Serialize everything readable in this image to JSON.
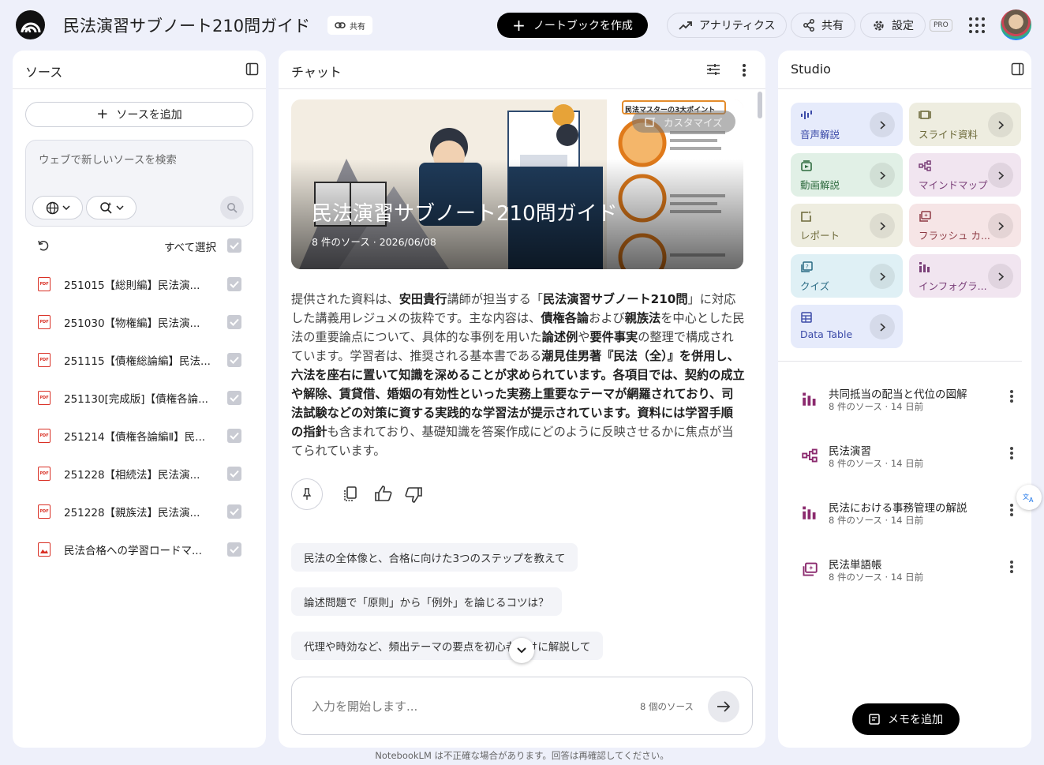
{
  "header": {
    "title": "民法演習サブノート210問ガイド",
    "share_chip": "共有",
    "create_button": "ノートブックを作成",
    "analytics_button": "アナリティクス",
    "share_button": "共有",
    "settings_button": "設定",
    "pro_badge": "PRO"
  },
  "sources": {
    "title": "ソース",
    "add_button": "ソースを追加",
    "search_placeholder": "ウェブで新しいソースを検索",
    "select_all": "すべて選択",
    "items": [
      {
        "label": "251015【総則編】民法演...",
        "type": "pdf"
      },
      {
        "label": "251030【物権編】民法演...",
        "type": "pdf"
      },
      {
        "label": "251115【債権総論編】民法...",
        "type": "pdf"
      },
      {
        "label": "251130[完成版]【債権各論...",
        "type": "pdf"
      },
      {
        "label": "251214【債権各論編Ⅱ】民...",
        "type": "pdf"
      },
      {
        "label": "251228【相続法】民法演...",
        "type": "pdf"
      },
      {
        "label": "251228【親族法】民法演...",
        "type": "pdf"
      },
      {
        "label": "民法合格への学習ロードマ...",
        "type": "image"
      }
    ]
  },
  "chat": {
    "title": "チャット",
    "hero_title": "民法演習サブノート210問ガイド",
    "hero_subtitle": "8 件のソース · 2026/06/08",
    "customize_button": "カスタマイズ",
    "infographic_heading": "民法マスターの3大ポイント",
    "summary_segments": [
      {
        "t": "提供された資料は、",
        "b": false
      },
      {
        "t": "安田貴行",
        "b": true
      },
      {
        "t": "講師が担当する「",
        "b": false
      },
      {
        "t": "民法演習サブノート210問",
        "b": true
      },
      {
        "t": "」に対応した講義用レジュメの抜粋です。主な内容は、",
        "b": false
      },
      {
        "t": "債権各論",
        "b": true
      },
      {
        "t": "および",
        "b": false
      },
      {
        "t": "親族法",
        "b": true
      },
      {
        "t": "を中心とした民法の重要論点について、具体的な事例を用いた",
        "b": false
      },
      {
        "t": "論述例",
        "b": true
      },
      {
        "t": "や",
        "b": false
      },
      {
        "t": "要件事実",
        "b": true
      },
      {
        "t": "の整理で構成されています。学習者は、推奨される基本書である",
        "b": false
      },
      {
        "t": "潮見佳男著『民法（全）』を併用し、六法を座右に置いて知識を深めることが求められています。各項目では、契約の成立や解除、賃貸借、婚姻の有効性といった実務上重要なテーマが網羅されており、司法試験などの対策に資する実践的な学習法が提示されています。資料には学習手順の指針",
        "b": true
      },
      {
        "t": "も含まれており、基礎知識を答案作成にどのように反映させるかに焦点が当てられています。",
        "b": false
      }
    ],
    "suggestions": [
      "民法の全体像と、合格に向けた3つのステップを教えて",
      "論述問題で「原則」から「例外」を論じるコツは？",
      "代理や時効など、頻出テーマの要点を初心者向けに解説して"
    ],
    "input_placeholder": "入力を開始します...",
    "source_count": "8 個のソース"
  },
  "studio": {
    "title": "Studio",
    "cards": [
      {
        "label": "音声解説",
        "bg": "#e6ebfb",
        "color": "#3b4aa8",
        "icon": "audio-icon"
      },
      {
        "label": "スライド資料",
        "bg": "#eeede0",
        "color": "#6d6a3a",
        "icon": "slides-icon"
      },
      {
        "label": "動画解説",
        "bg": "#e1f0e6",
        "color": "#2f6b3f",
        "icon": "video-icon"
      },
      {
        "label": "マインドマップ",
        "bg": "#f1e5f0",
        "color": "#7a3f78",
        "icon": "mindmap-icon"
      },
      {
        "label": "レポート",
        "bg": "#eeede0",
        "color": "#6d6a3a",
        "icon": "report-icon"
      },
      {
        "label": "フラッシュ カ...",
        "bg": "#f6e5e6",
        "color": "#8d3a44",
        "icon": "flashcard-icon"
      },
      {
        "label": "クイズ",
        "bg": "#dff0f5",
        "color": "#2a6b84",
        "icon": "quiz-icon"
      },
      {
        "label": "インフォグラ...",
        "bg": "#f1e5f0",
        "color": "#7a3f78",
        "icon": "infographic-icon"
      },
      {
        "label": "Data Table",
        "bg": "#e6ebfb",
        "color": "#3b4aa8",
        "icon": "table-icon"
      }
    ],
    "notes": [
      {
        "title": "共同抵当の配当と代位の図解",
        "meta": "8 件のソース · 14 日前",
        "icon": "infographic-icon"
      },
      {
        "title": "民法演習",
        "meta": "8 件のソース · 14 日前",
        "icon": "mindmap-icon"
      },
      {
        "title": "民法における事務管理の解説",
        "meta": "8 件のソース · 14 日前",
        "icon": "infographic-icon"
      },
      {
        "title": "民法単語帳",
        "meta": "8 件のソース · 14 日前",
        "icon": "flashcard-icon"
      }
    ],
    "memo_button": "メモを追加"
  },
  "footer": "NotebookLM は不正確な場合があります。回答は再確認してください。",
  "colors": {
    "accent_note": "#8b2a6e",
    "checkbox": "#c9cbd3"
  }
}
